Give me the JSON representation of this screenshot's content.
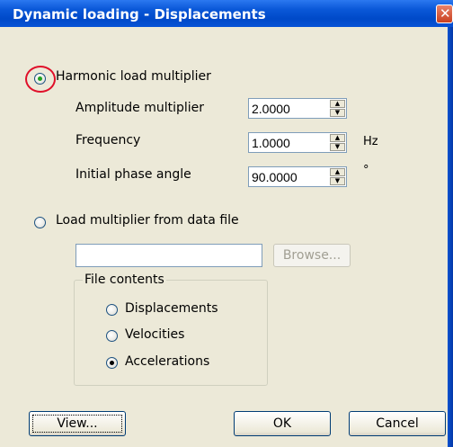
{
  "window": {
    "title": "Dynamic loading - Displacements",
    "close_glyph": "✕"
  },
  "harmonic": {
    "label": "Harmonic load multiplier",
    "selected": true,
    "fields": [
      {
        "label": "Amplitude multiplier",
        "value": "2.0000",
        "unit": ""
      },
      {
        "label": "Frequency",
        "value": "1.0000",
        "unit": "Hz"
      },
      {
        "label": "Initial phase angle",
        "value": "90.0000",
        "unit": "°"
      }
    ]
  },
  "datafile": {
    "label": "Load multiplier from data file",
    "selected": false,
    "path_value": "",
    "browse_label": "Browse..."
  },
  "file_contents": {
    "title": "File contents",
    "options": [
      {
        "label": "Displacements",
        "selected": false
      },
      {
        "label": "Velocities",
        "selected": false
      },
      {
        "label": "Accelerations",
        "selected": true
      }
    ]
  },
  "buttons": {
    "view": "View...",
    "ok": "OK",
    "cancel": "Cancel"
  },
  "icons": {
    "close": "close-icon",
    "spin_up": "arrow-up-icon",
    "spin_down": "arrow-down-icon"
  },
  "colors": {
    "title_bar": "#0a58d8",
    "dialog_bg": "#ece9d8",
    "radio_dot": "#21a121",
    "highlight": "#e0102a"
  }
}
